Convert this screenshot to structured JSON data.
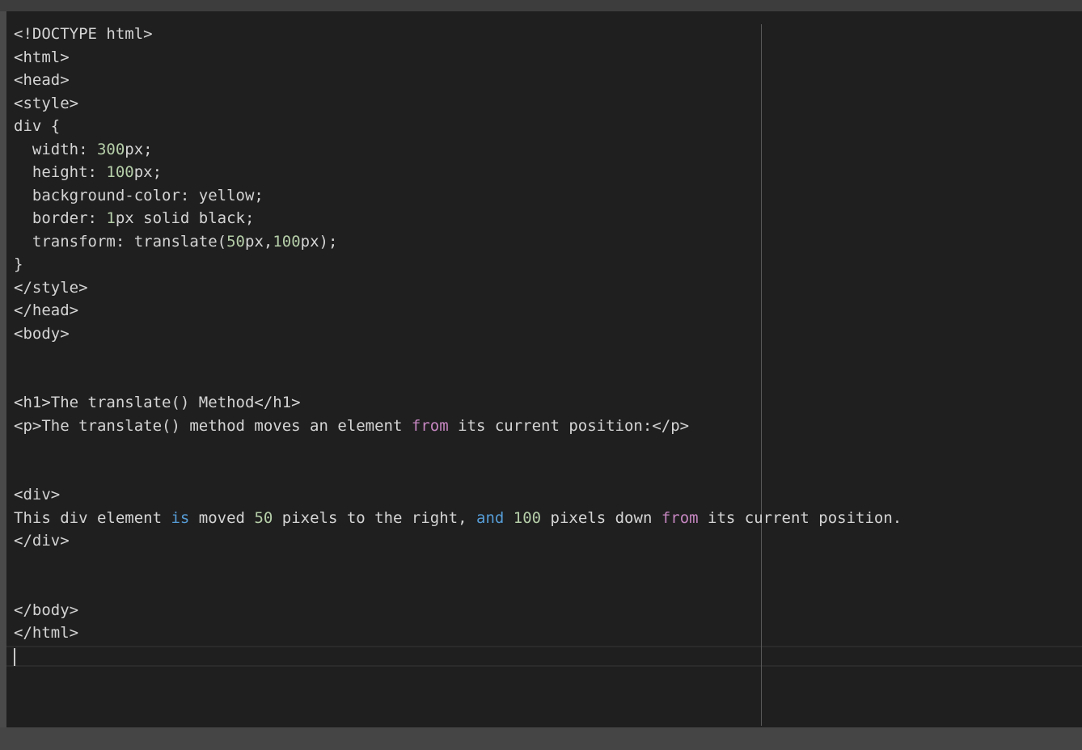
{
  "editor": {
    "lines": [
      [
        {
          "t": "<!DOCTYPE html>",
          "c": ""
        }
      ],
      [
        {
          "t": "<html>",
          "c": ""
        }
      ],
      [
        {
          "t": "<head>",
          "c": ""
        }
      ],
      [
        {
          "t": "<style>",
          "c": ""
        }
      ],
      [
        {
          "t": "div {",
          "c": ""
        }
      ],
      [
        {
          "t": "  width: ",
          "c": ""
        },
        {
          "t": "300",
          "c": "num"
        },
        {
          "t": "px;",
          "c": ""
        }
      ],
      [
        {
          "t": "  height: ",
          "c": ""
        },
        {
          "t": "100",
          "c": "num"
        },
        {
          "t": "px;",
          "c": ""
        }
      ],
      [
        {
          "t": "  background-color: yellow;",
          "c": ""
        }
      ],
      [
        {
          "t": "  border: ",
          "c": ""
        },
        {
          "t": "1",
          "c": "num"
        },
        {
          "t": "px solid black;",
          "c": ""
        }
      ],
      [
        {
          "t": "  transform: translate(",
          "c": ""
        },
        {
          "t": "50",
          "c": "num"
        },
        {
          "t": "px,",
          "c": ""
        },
        {
          "t": "100",
          "c": "num"
        },
        {
          "t": "px);",
          "c": ""
        }
      ],
      [
        {
          "t": "}",
          "c": ""
        }
      ],
      [
        {
          "t": "</style>",
          "c": ""
        }
      ],
      [
        {
          "t": "</head>",
          "c": ""
        }
      ],
      [
        {
          "t": "<body>",
          "c": ""
        }
      ],
      [],
      [],
      [
        {
          "t": "<h1>The translate() Method</h1>",
          "c": ""
        }
      ],
      [
        {
          "t": "<p>The translate() method moves an element ",
          "c": ""
        },
        {
          "t": "from",
          "c": "ctl"
        },
        {
          "t": " its current position:</p>",
          "c": ""
        }
      ],
      [],
      [],
      [
        {
          "t": "<div>",
          "c": ""
        }
      ],
      [
        {
          "t": "This div element ",
          "c": ""
        },
        {
          "t": "is",
          "c": "kw"
        },
        {
          "t": " moved ",
          "c": ""
        },
        {
          "t": "50",
          "c": "num"
        },
        {
          "t": " pixels to the right, ",
          "c": ""
        },
        {
          "t": "and",
          "c": "kw"
        },
        {
          "t": " ",
          "c": ""
        },
        {
          "t": "100",
          "c": "num"
        },
        {
          "t": " pixels down ",
          "c": ""
        },
        {
          "t": "from",
          "c": "ctl"
        },
        {
          "t": " its current position.",
          "c": ""
        }
      ],
      [
        {
          "t": "</div>",
          "c": ""
        }
      ],
      [],
      [],
      [
        {
          "t": "</body>",
          "c": ""
        }
      ],
      [
        {
          "t": "</html>",
          "c": ""
        }
      ],
      []
    ]
  },
  "colors": {
    "background": "#1f1f1f",
    "text": "#d4d4d4",
    "number": "#b5cea8",
    "keyword": "#569cd6",
    "control": "#c586c0"
  }
}
